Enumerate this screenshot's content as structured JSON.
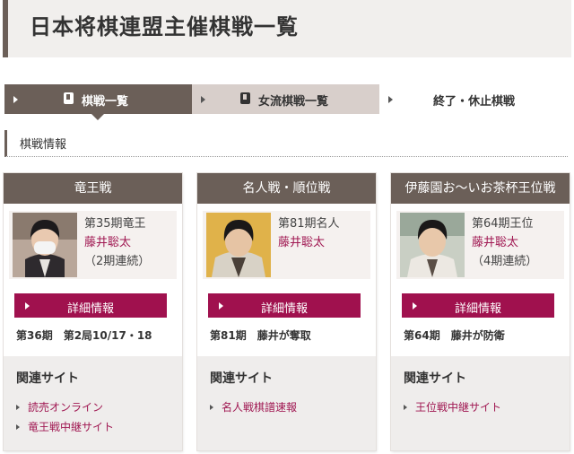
{
  "page_title": "日本将棋連盟主催棋戦一覧",
  "tabs": [
    {
      "label": "棋戦一覧"
    },
    {
      "label": "女流棋戦一覧"
    },
    {
      "label": "終了・休止棋戦"
    }
  ],
  "section_heading": "棋戦情報",
  "cards": [
    {
      "title": "竜王戦",
      "term": "第35期竜王",
      "name": "藤井聡太",
      "note": "（2期連続）",
      "detail_label": "詳細情報",
      "status": "第36期　第2局10/17・18",
      "related_heading": "関連サイト",
      "links": [
        "読売オンライン",
        "竜王戦中継サイト"
      ]
    },
    {
      "title": "名人戦・順位戦",
      "term": "第81期名人",
      "name": "藤井聡太",
      "note": "",
      "detail_label": "詳細情報",
      "status": "第81期　藤井が奪取",
      "related_heading": "関連サイト",
      "links": [
        "名人戦棋譜速報"
      ]
    },
    {
      "title": "伊藤園お～いお茶杯王位戦",
      "term": "第64期王位",
      "name": "藤井聡太",
      "note": "（4期連続）",
      "detail_label": "詳細情報",
      "status": "第64期　藤井が防衛",
      "related_heading": "関連サイト",
      "links": [
        "王位戦中継サイト"
      ]
    }
  ],
  "colors": {
    "brand_brown": "#6b5f58",
    "accent_crimson": "#a0114e",
    "link_crimson": "#a01852",
    "tab_inactive": "#d8cfcb"
  }
}
